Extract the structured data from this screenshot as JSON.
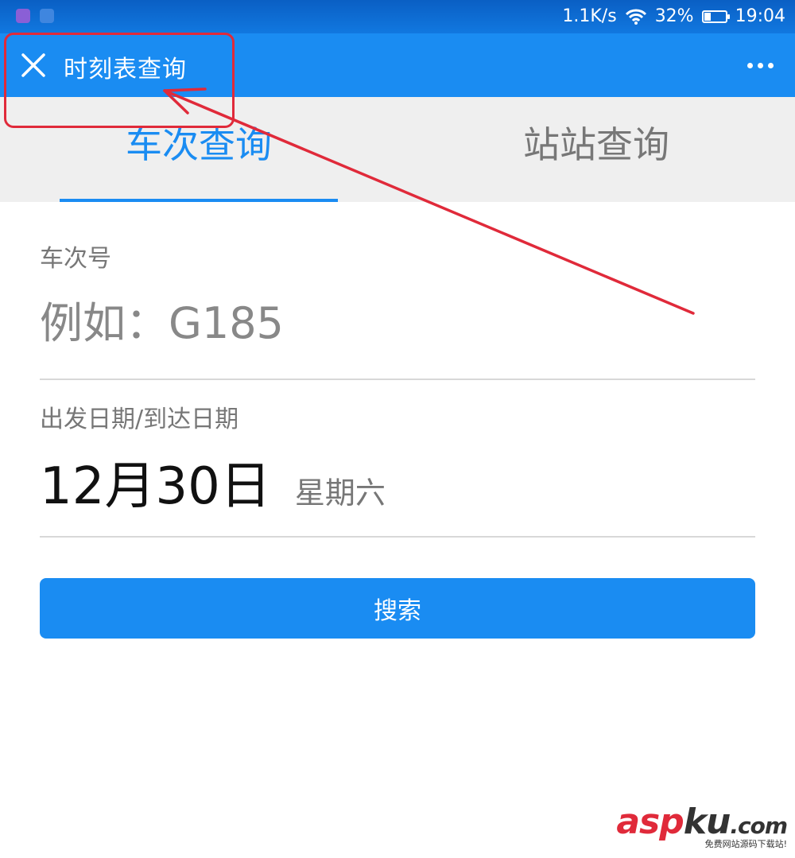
{
  "status_bar": {
    "network_speed": "1.1K/s",
    "battery_percent": "32%",
    "battery_level": 0.32,
    "time": "19:04",
    "icons": [
      "gallery-icon",
      "notification-icon",
      "wifi-icon",
      "battery-icon"
    ]
  },
  "nav": {
    "title": "时刻表查询",
    "close_icon": "close-icon",
    "more_icon": "more-dots-icon"
  },
  "tabs": [
    {
      "label": "车次查询",
      "active": true
    },
    {
      "label": "站站查询",
      "active": false
    }
  ],
  "form": {
    "train_label": "车次号",
    "train_placeholder": "例如：G185",
    "train_value": "",
    "date_label": "出发日期/到达日期",
    "date_value": "12月30日",
    "weekday": "星期六",
    "search_label": "搜索"
  },
  "watermark": {
    "part1": "asp",
    "part2": "ku",
    "part3": ".com",
    "sub": "免费网站源码下载站!"
  },
  "colors": {
    "accent": "#1a8cf2",
    "annotation": "#e02a3a",
    "tab_bg": "#efefef"
  }
}
